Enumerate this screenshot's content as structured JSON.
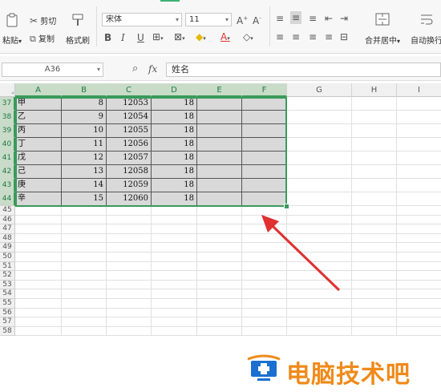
{
  "toolbar": {
    "paste_label": "粘贴",
    "cut_label": "剪切",
    "copy_label": "复制",
    "format_painter_label": "格式刷",
    "font_name": "宋体",
    "font_size": "11",
    "bold": "B",
    "italic": "I",
    "underline": "U",
    "font_color_letter": "A",
    "merge_center_label": "合并居中",
    "wrap_text_label": "自动换行"
  },
  "formula_bar": {
    "name_box": "A36",
    "fx_label": "fx",
    "formula": "姓名"
  },
  "columns": [
    "A",
    "B",
    "C",
    "D",
    "E",
    "F",
    "G",
    "H",
    "I"
  ],
  "selected_columns": [
    "A",
    "B",
    "C",
    "D",
    "E",
    "F"
  ],
  "rows": [
    {
      "num": "37",
      "a": "甲",
      "b": "8",
      "c": "12053",
      "d": "18"
    },
    {
      "num": "38",
      "a": "乙",
      "b": "9",
      "c": "12054",
      "d": "18"
    },
    {
      "num": "39",
      "a": "丙",
      "b": "10",
      "c": "12055",
      "d": "18"
    },
    {
      "num": "40",
      "a": "丁",
      "b": "11",
      "c": "12056",
      "d": "18"
    },
    {
      "num": "41",
      "a": "戊",
      "b": "12",
      "c": "12057",
      "d": "18"
    },
    {
      "num": "42",
      "a": "己",
      "b": "13",
      "c": "12058",
      "d": "18"
    },
    {
      "num": "43",
      "a": "庚",
      "b": "14",
      "c": "12059",
      "d": "18"
    },
    {
      "num": "44",
      "a": "辛",
      "b": "15",
      "c": "12060",
      "d": "18"
    }
  ],
  "empty_rows": [
    "45",
    "46",
    "47",
    "48",
    "49",
    "50",
    "51",
    "52",
    "53",
    "54",
    "55",
    "56",
    "57",
    "58"
  ],
  "watermark": {
    "text": "电脑技术吧",
    "color": "#f08a1a"
  },
  "colors": {
    "selection": "#3a9a5a",
    "arrow": "#e03030",
    "shaded_cell": "#d9d9d9"
  }
}
